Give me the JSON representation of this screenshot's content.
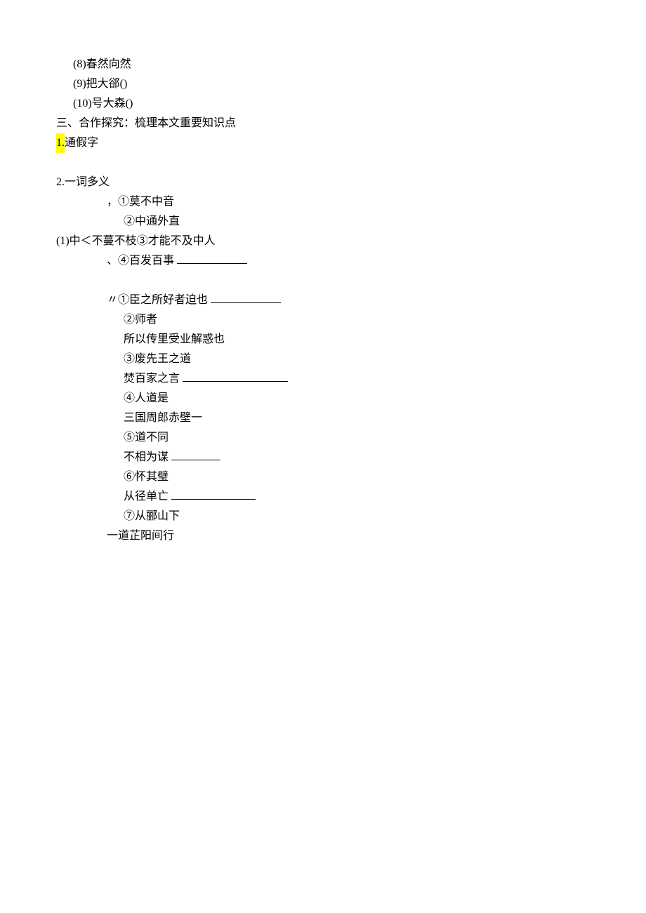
{
  "lines": {
    "l8": "(8)春然向然",
    "l9": "(9)把大郤()",
    "l10": "(10)号大森()",
    "sec3": "三、合作探究：梳理本文重要知识点",
    "h1_prefix": "1.",
    "h1_rest": "通假字",
    "h2": "2.一词多义",
    "g1_a": "，①莫不中音",
    "g1_b": "②中通外直",
    "g1_main": "(1)中＜不蔓不枝③才能不及中人",
    "g1_c": "、④百发百事",
    "g2_a": "〃①臣之所好者迫也",
    "g2_b": "②师者",
    "g2_c": "所以传里受业解惑也",
    "g2_d": "③废先王之道",
    "g2_e": "焚百家之言",
    "g2_f": "④人道是",
    "g2_g": "三国周郎赤壁一",
    "g2_h": "⑤道不同",
    "g2_i": "不相为谋",
    "g2_j": "⑥怀其璧",
    "g2_k": "从径单亡",
    "g2_l": "⑦从郦山下",
    "g2_m": "一道芷阳间行"
  }
}
